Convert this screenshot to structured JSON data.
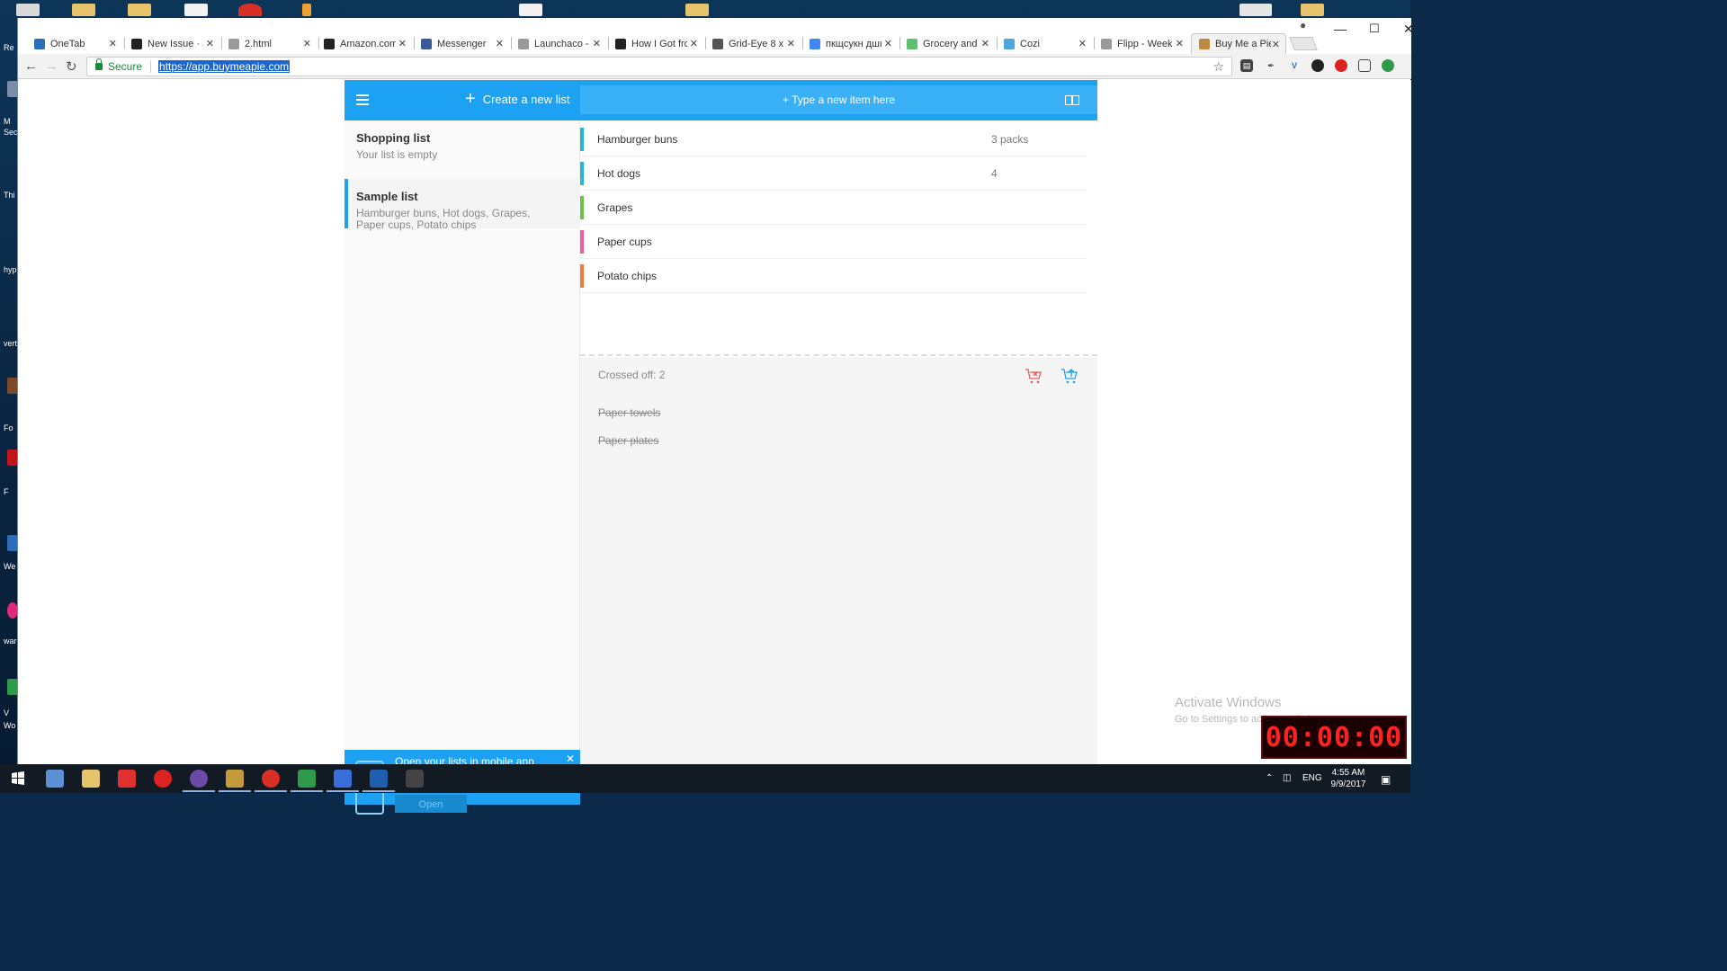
{
  "browser": {
    "tabs": [
      {
        "title": "OneTab",
        "icon": "onetab-icon",
        "color": "#2a6ebb"
      },
      {
        "title": "New Issue · a",
        "icon": "github-icon",
        "color": "#222222"
      },
      {
        "title": "2.html",
        "icon": "file-icon",
        "color": "#9a9a9a"
      },
      {
        "title": "Amazon.com",
        "icon": "amazon-icon",
        "color": "#222222"
      },
      {
        "title": "Messenger",
        "icon": "facebook-icon",
        "color": "#3b5998"
      },
      {
        "title": "Launchaco - I",
        "icon": "page-icon",
        "color": "#9a9a9a"
      },
      {
        "title": "How I Got fro",
        "icon": "medium-icon",
        "color": "#222222"
      },
      {
        "title": "Grid-Eye 8 x 8",
        "icon": "bolt-icon",
        "color": "#555555"
      },
      {
        "title": "пкщсукн дшы",
        "icon": "google-icon",
        "color": "#4285f4"
      },
      {
        "title": "Grocery and",
        "icon": "grocery-icon",
        "color": "#5fbf6f"
      },
      {
        "title": "Cozi",
        "icon": "cozi-icon",
        "color": "#4fa6d8"
      },
      {
        "title": "Flipp - Week",
        "icon": "flipp-icon",
        "color": "#9a9a9a"
      },
      {
        "title": "Buy Me a Pie",
        "icon": "pie-icon",
        "color": "#c08a3e"
      }
    ],
    "secure_label": "Secure",
    "url": "https://app.buymeapie.com"
  },
  "app": {
    "create_label": "Create a new list",
    "add_placeholder": "+ Type a new item here",
    "lists": [
      {
        "name": "Shopping list",
        "desc": "Your list is empty"
      },
      {
        "name": "Sample list",
        "desc": "Hamburger buns, Hot dogs, Grapes, Paper cups, Potato chips"
      }
    ],
    "items": [
      {
        "label": "Hamburger buns",
        "qty": "3 packs",
        "color": "#26b5d6"
      },
      {
        "label": "Hot dogs",
        "qty": "4",
        "color": "#26b5d6"
      },
      {
        "label": "Grapes",
        "qty": "",
        "color": "#6cc04a"
      },
      {
        "label": "Paper cups",
        "qty": "",
        "color": "#f05a9e"
      },
      {
        "label": "Potato chips",
        "qty": "",
        "color": "#f27b3a"
      }
    ],
    "crossed_label": "Crossed off: 2",
    "crossed_items": [
      "Paper towels",
      "Paper plates"
    ],
    "promo_text": "Open your lists in mobile app",
    "promo_button": "Open"
  },
  "overlay": {
    "activate_title": "Activate Windows",
    "activate_sub": "Go to Settings to activate Windows.",
    "timer": "00:00:00"
  },
  "taskbar": {
    "lang": "ENG",
    "time": "4:55 AM",
    "date": "9/9/2017"
  },
  "desktop_labels": [
    "Re",
    "M",
    "Sec",
    "Thi",
    "hyp",
    "vert",
    "Fo",
    "F",
    "We",
    "war",
    "V",
    "Wo"
  ]
}
